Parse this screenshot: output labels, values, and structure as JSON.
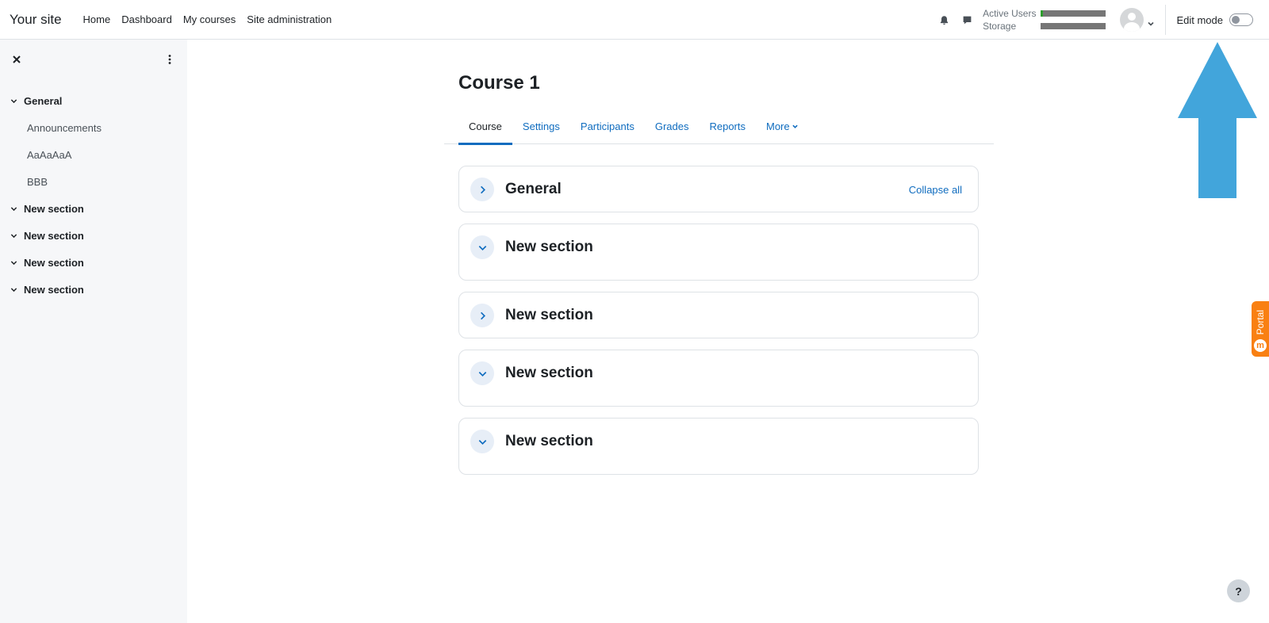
{
  "navbar": {
    "brand": "Your site",
    "links": [
      "Home",
      "Dashboard",
      "My courses",
      "Site administration"
    ],
    "quota": {
      "active_users_label": "Active Users",
      "active_users_fraction": 0.03,
      "storage_label": "Storage",
      "storage_fraction": 0.0
    },
    "edit_mode_label": "Edit mode",
    "edit_mode_on": false
  },
  "drawer": {
    "index": [
      {
        "type": "section",
        "label": "General"
      },
      {
        "type": "activity",
        "label": "Announcements"
      },
      {
        "type": "activity",
        "label": "AaAaAaA"
      },
      {
        "type": "activity",
        "label": "BBB"
      },
      {
        "type": "section",
        "label": "New section"
      },
      {
        "type": "section",
        "label": "New section"
      },
      {
        "type": "section",
        "label": "New section"
      },
      {
        "type": "section",
        "label": "New section"
      }
    ]
  },
  "course": {
    "title": "Course 1",
    "tabs": [
      "Course",
      "Settings",
      "Participants",
      "Grades",
      "Reports",
      "More"
    ],
    "active_tab": "Course",
    "collapse_all_label": "Collapse all",
    "sections": [
      {
        "title": "General",
        "state": "collapsed"
      },
      {
        "title": "New section",
        "state": "expanded"
      },
      {
        "title": "New section",
        "state": "collapsed"
      },
      {
        "title": "New section",
        "state": "expanded"
      },
      {
        "title": "New section",
        "state": "expanded"
      }
    ]
  },
  "portal_tab": {
    "label": "Portal",
    "icon_letter": "m"
  },
  "help_label": "?",
  "colors": {
    "accent": "#0f6cbf",
    "drawer_bg": "#f6f7f9",
    "arrow": "#42a5db",
    "portal": "#f98012"
  }
}
